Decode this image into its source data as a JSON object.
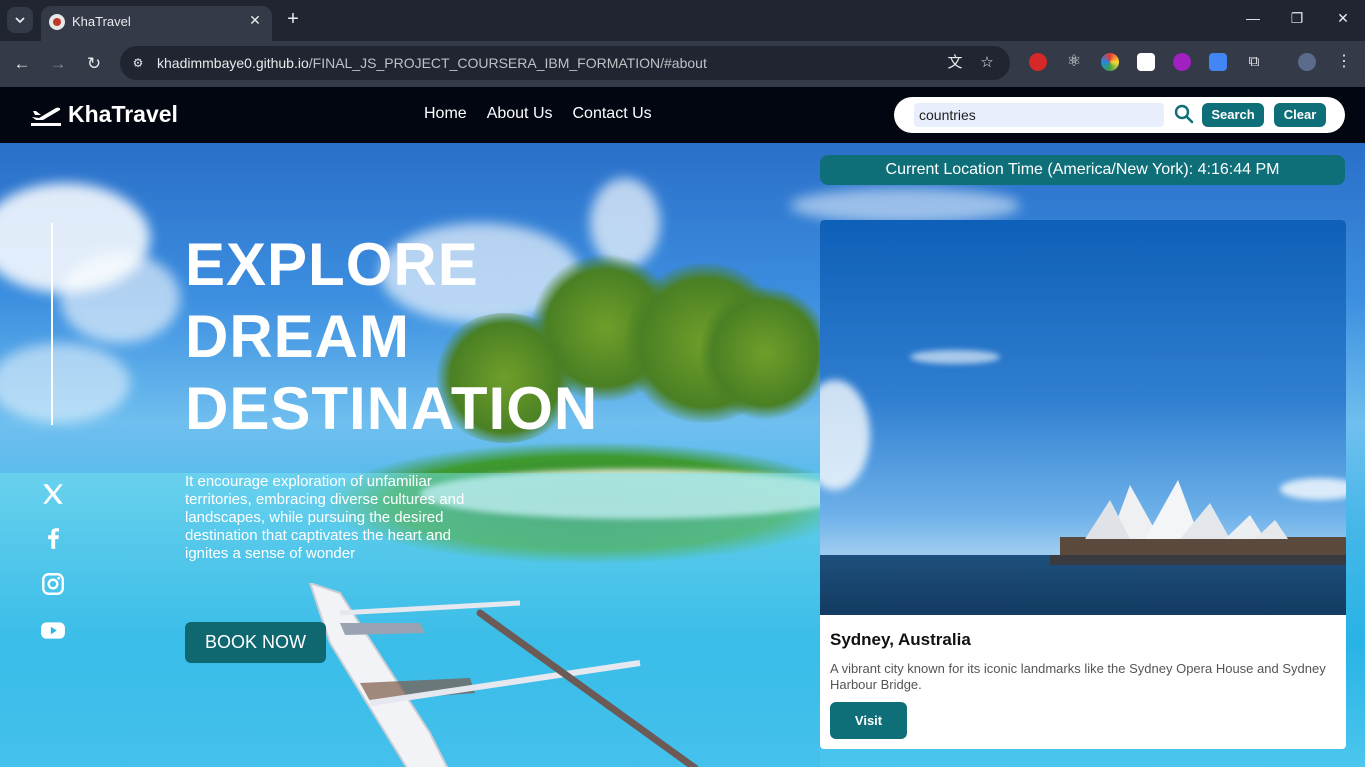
{
  "browser": {
    "tab_title": "KhaTravel",
    "url_host": "khadimmbaye0.github.io",
    "url_path": "/FINAL_JS_PROJECT_COURSERA_IBM_FORMATION/#about"
  },
  "site": {
    "brand": "KhaTravel",
    "nav": [
      "Home",
      "About Us",
      "Contact Us"
    ],
    "search": {
      "value": "countries",
      "search_label": "Search",
      "clear_label": "Clear"
    }
  },
  "hero": {
    "title_lines": [
      "EXPLORE",
      "DREAM",
      "DESTINATION"
    ],
    "text": "It encourage exploration of unfamiliar territories, embracing diverse cultures and landscapes, while pursuing the desired destination that captivates the heart and ignites a sense of wonder",
    "book_label": "BOOK NOW",
    "social_icons": [
      "x-icon",
      "facebook-icon",
      "instagram-icon",
      "youtube-icon"
    ]
  },
  "time_bar": "Current Location Time (America/New York): 4:16:44 PM",
  "card": {
    "title": "Sydney, Australia",
    "description": "A vibrant city known for its iconic landmarks like the Sydney Opera House and Sydney Harbour Bridge.",
    "visit_label": "Visit"
  },
  "colors": {
    "accent": "#0f6f78",
    "nav_bg": "#020611",
    "chrome_dark": "#202531",
    "chrome_mid": "#343a48"
  }
}
